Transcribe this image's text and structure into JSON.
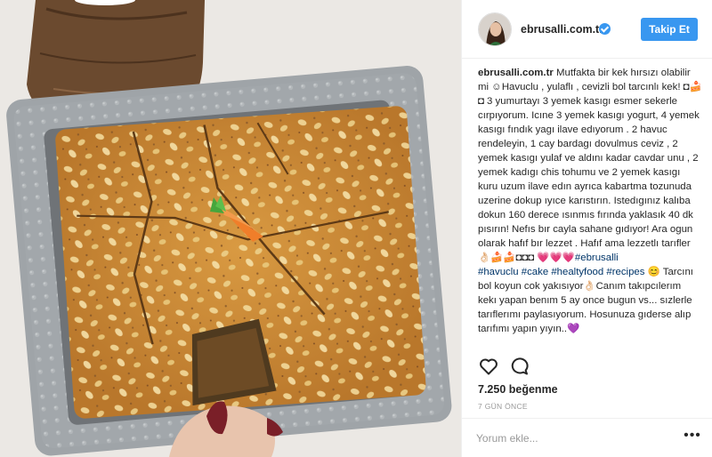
{
  "post": {
    "username": "ebrusalli.com.tr",
    "follow_label": "Takip Et",
    "caption_user": "ebrusalli.com.tr",
    "caption_text": " Mutfakta bir kek hırsızı olabilir mi ☺Havuclu , yulaflı , cevizli bol tarcınlı kek! ◘🍰◘ 3 yumurtayı 3 yemek kasıgı esmer sekerle cırpıyorum. Icıne 3 yemek kasıgı yogurt, 4 yemek kasıgı fındık yagı ilave edıyorum . 2 havuc rendeleyin, 1 cay bardagı dovulmus ceviz , 2 yemek kasıgı yulaf ve aldını kadar cavdar unu , 2 yemek kadıgı chis tohumu ve 2 yemek kasıgı kuru uzum ilave edın ayrıca kabartma tozunuda uzerine dokup ıyıce karıstırın. Istedıgınız kalıba dokun 160 derece ısınmıs fırında yaklasık 40 dk pısırın! Nefıs bır cayla sahane gıdıyor! Ara ogun olarak hafıf bır lezzet . Hafıf ama lezzetlı tarıfler 👌🏻🍰🍰◘◘◘ 💗💗💗",
    "hashtags_inline": "#ebrusalli",
    "hashtags_line": "#havuclu #cake #healtyfood #recipes",
    "caption_tail": " 😊 Tarcını bol koyun cok yakısıyor👌🏻Canım takıpcılerım kekı yapan benım 5 ay once bugun vs... sızlerle tarıflerımı paylasıyorum. Hosunuza gıderse alıp tarıfımı yapın yıyın..💜",
    "likes": "7.250 beğenme",
    "time_ago": "7 GÜN ÖNCE",
    "comment_placeholder": "Yorum ekle...",
    "more_label": "•••"
  },
  "icons": {
    "like": "heart-icon",
    "comment": "speech-bubble-icon",
    "verified": "verified-badge-icon",
    "more": "more-options-icon"
  },
  "colors": {
    "follow_button": "#3897f0",
    "hashtag": "#003569",
    "verified": "#3897f0",
    "muted": "#999999"
  }
}
